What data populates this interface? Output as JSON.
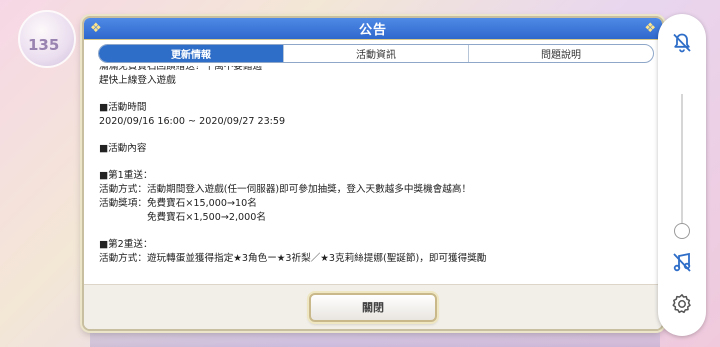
{
  "background": {
    "badge_text": "135"
  },
  "dialog": {
    "title": "公告",
    "tabs": [
      {
        "label": "更新情報",
        "active": true
      },
      {
        "label": "活動資訊",
        "active": false
      },
      {
        "label": "問題說明",
        "active": false
      }
    ],
    "content_lines": [
      "滿滿免費寶石回饋贈送！千萬不要錯過",
      "趕快上線登入遊戲",
      "",
      "■活動時間",
      "2020/09/16 16:00 ~ 2020/09/27 23:59",
      "",
      "■活動內容",
      "",
      "■第1重送：",
      "活動方式：活動期間登入遊戲(任一伺服器)即可參加抽獎，登入天數越多中獎機會越高！",
      "活動獎項：免費寶石×15,000→10名",
      "　　　　　免費寶石×1,500→2,000名",
      "",
      "■第2重送：",
      "活動方式：遊玩轉蛋並獲得指定★3角色ー★3祈梨／★3克莉絲提娜(聖誕節)，即可獲得獎勵"
    ],
    "close_label": "關閉"
  },
  "side_panel": {
    "icons": [
      "bell-off-icon",
      "music-off-icon",
      "gear-icon"
    ],
    "volume_level": 0.0
  },
  "colors": {
    "header_blue": "#2f68cc",
    "tab_active": "#2f6ec8",
    "gold_border": "#c9b98a"
  }
}
